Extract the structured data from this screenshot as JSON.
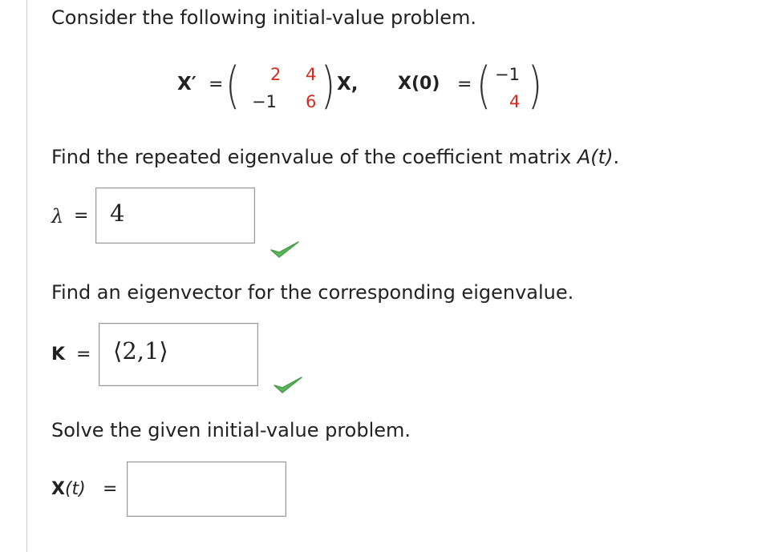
{
  "intro": "Consider the following initial-value problem.",
  "equation": {
    "lhs": "X′",
    "equals": "=",
    "matrix": [
      [
        "2",
        "4"
      ],
      [
        "−1",
        "6"
      ]
    ],
    "vector_var": "X,",
    "initial_lhs": "X(0)",
    "initial_equals": "=",
    "initial_vector": [
      "−1",
      "4"
    ]
  },
  "q1": {
    "prompt_prefix": "Find the repeated eigenvalue of the coefficient matrix ",
    "prompt_var": "A(t)",
    "prompt_suffix": ".",
    "label": "λ",
    "equals": "=",
    "answer": "4",
    "status": "correct"
  },
  "q2": {
    "prompt": "Find an eigenvector for the corresponding eigenvalue.",
    "label": "K",
    "equals": "=",
    "answer": "⟨2,1⟩",
    "status": "correct"
  },
  "q3": {
    "prompt": "Solve the given initial-value problem.",
    "label_bold": "X",
    "label_rest": "(t)",
    "equals": "=",
    "answer": ""
  },
  "colors": {
    "matrix_entry": "#d62b1f",
    "check": "#5cb85c"
  },
  "icons": {
    "check": "check-icon"
  }
}
